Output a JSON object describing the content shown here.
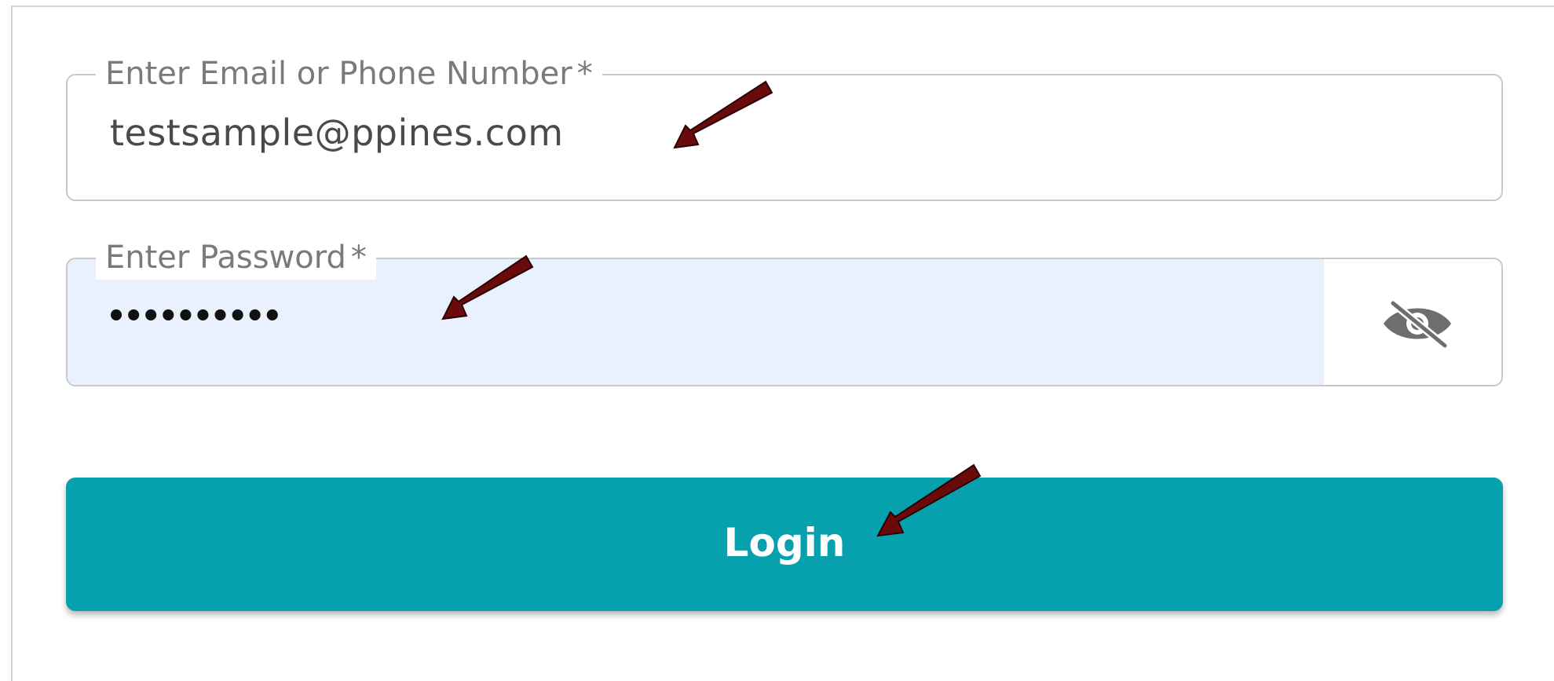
{
  "form": {
    "email": {
      "label": "Enter Email or Phone Number",
      "required_mark": "*",
      "value": "testsample@ppines.com"
    },
    "password": {
      "label": "Enter Password",
      "required_mark": "*",
      "masked_value": "••••••••••",
      "toggle_icon": "eye-off-icon"
    },
    "login": {
      "label": "Login"
    }
  },
  "colors": {
    "primary": "#07a1ad",
    "autofill_background": "#e9f0fe",
    "annotation_arrow": "#6b0a0a"
  }
}
